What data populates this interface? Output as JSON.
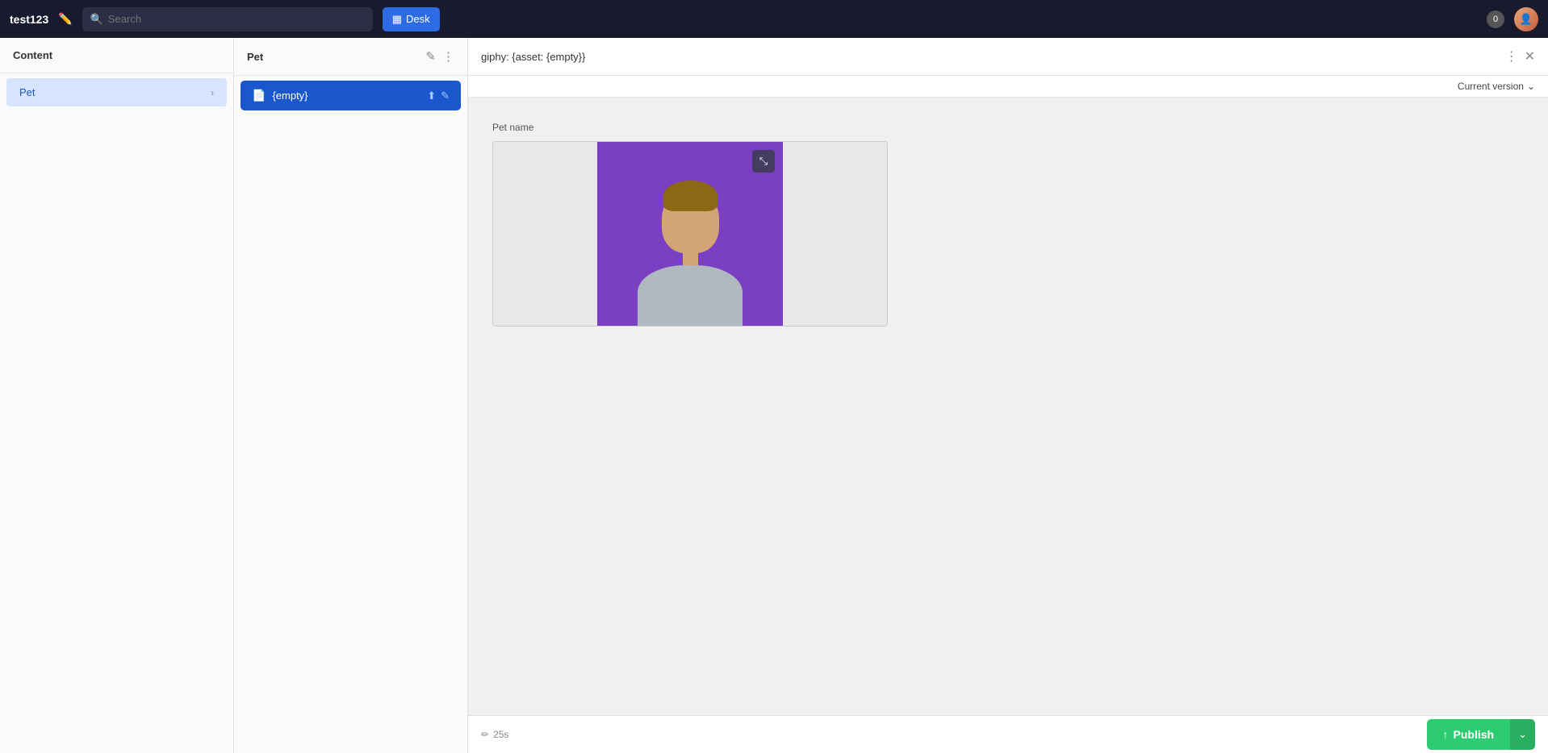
{
  "nav": {
    "app_title": "test123",
    "search_placeholder": "Search",
    "desk_label": "Desk",
    "badge_count": "0"
  },
  "sidebar_content": {
    "header_label": "Content",
    "items": [
      {
        "label": "Pet"
      }
    ]
  },
  "sidebar_pet": {
    "header_label": "Pet",
    "entries": [
      {
        "label": "{empty}"
      }
    ]
  },
  "editor": {
    "title": "giphy: {asset: {empty}}",
    "version_label": "Current version",
    "field_label": "Pet name",
    "save_indicator": "25s"
  },
  "footer": {
    "publish_label": "Publish"
  }
}
